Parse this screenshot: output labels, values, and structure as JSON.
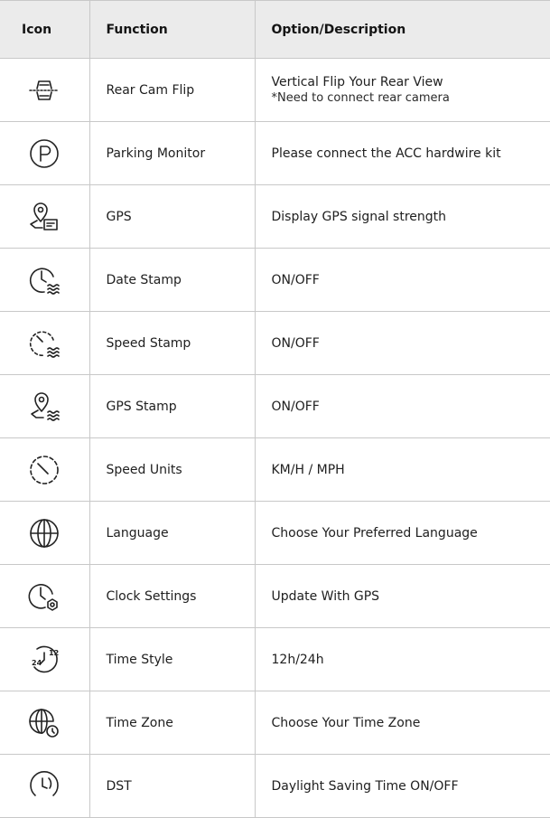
{
  "header": {
    "icon": "Icon",
    "function": "Function",
    "description": "Option/Description"
  },
  "rows": [
    {
      "icon": "rear-cam-flip-icon",
      "function": "Rear Cam Flip",
      "description": "Vertical Flip Your Rear View",
      "note": "*Need to connect rear camera"
    },
    {
      "icon": "parking-icon",
      "function": "Parking Monitor",
      "description": "Please connect the ACC hardwire kit"
    },
    {
      "icon": "gps-icon",
      "function": "GPS",
      "description": "Display GPS signal strength"
    },
    {
      "icon": "date-stamp-icon",
      "function": "Date Stamp",
      "description": "ON/OFF"
    },
    {
      "icon": "speed-stamp-icon",
      "function": "Speed Stamp",
      "description": "ON/OFF"
    },
    {
      "icon": "gps-stamp-icon",
      "function": "GPS Stamp",
      "description": "ON/OFF"
    },
    {
      "icon": "speedometer-icon",
      "function": "Speed Units",
      "description": "KM/H / MPH"
    },
    {
      "icon": "globe-icon",
      "function": "Language",
      "description": "Choose Your Preferred Language"
    },
    {
      "icon": "clock-gear-icon",
      "function": "Clock Settings",
      "description": "Update With GPS"
    },
    {
      "icon": "time-style-icon",
      "function": "Time Style",
      "description": "12h/24h",
      "icon_text": {
        "top": "12",
        "bottom": "24"
      }
    },
    {
      "icon": "globe-clock-icon",
      "function": "Time Zone",
      "description": "Choose Your Time Zone"
    },
    {
      "icon": "dst-clock-icon",
      "function": "DST",
      "description": "Daylight Saving Time ON/OFF"
    }
  ]
}
